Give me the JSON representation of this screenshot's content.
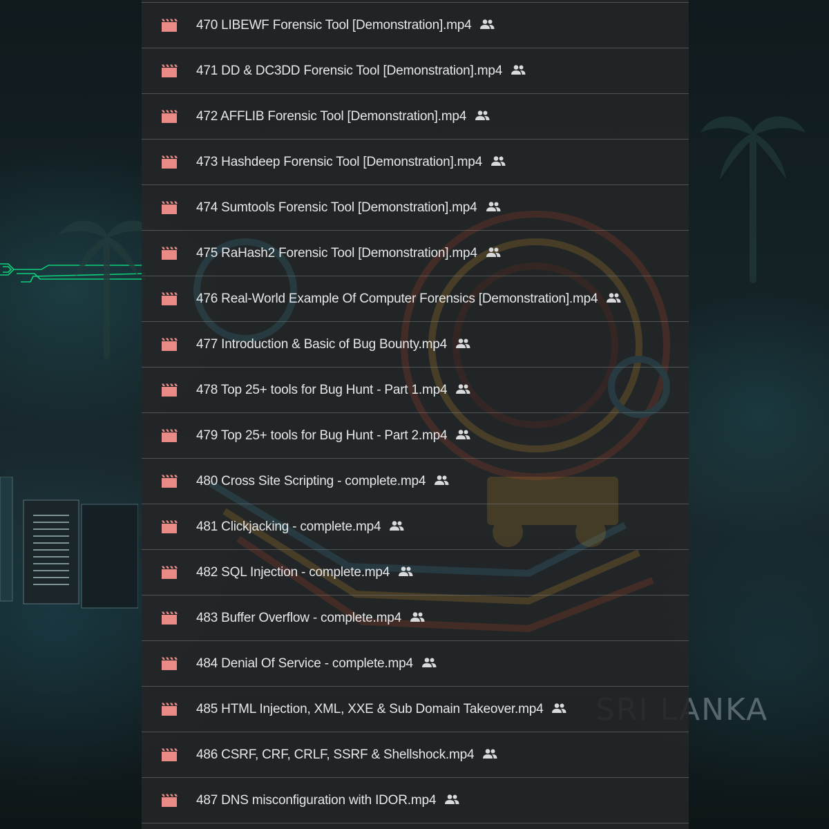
{
  "background": {
    "watermark_text": "SRI LANKA",
    "accent_color": "#0fd07a"
  },
  "file_list": {
    "file_icon": "video-file-icon",
    "shared_icon": "shared-people-icon",
    "file_icon_color": "#e98a86",
    "items": [
      {
        "name": "470 LIBEWF Forensic Tool [Demonstration].mp4",
        "shared": true
      },
      {
        "name": "471 DD & DC3DD Forensic Tool [Demonstration].mp4",
        "shared": true
      },
      {
        "name": "472 AFFLIB Forensic Tool [Demonstration].mp4",
        "shared": true
      },
      {
        "name": "473 Hashdeep Forensic Tool [Demonstration].mp4",
        "shared": true
      },
      {
        "name": "474 Sumtools Forensic Tool [Demonstration].mp4",
        "shared": true
      },
      {
        "name": "475 RaHash2 Forensic Tool [Demonstration].mp4",
        "shared": true
      },
      {
        "name": "476 Real-World Example Of Computer Forensics [Demonstration].mp4",
        "shared": true
      },
      {
        "name": "477 Introduction & Basic of Bug Bounty.mp4",
        "shared": true
      },
      {
        "name": "478 Top 25+ tools for Bug Hunt - Part 1.mp4",
        "shared": true
      },
      {
        "name": "479 Top 25+ tools for Bug Hunt - Part 2.mp4",
        "shared": true
      },
      {
        "name": "480 Cross Site Scripting - complete.mp4",
        "shared": true
      },
      {
        "name": "481 Clickjacking - complete.mp4",
        "shared": true
      },
      {
        "name": "482 SQL Injection - complete.mp4",
        "shared": true
      },
      {
        "name": "483 Buffer Overflow - complete.mp4",
        "shared": true
      },
      {
        "name": "484 Denial Of Service - complete.mp4",
        "shared": true
      },
      {
        "name": "485 HTML Injection, XML, XXE & Sub Domain Takeover.mp4",
        "shared": true
      },
      {
        "name": "486 CSRF, CRF, CRLF, SSRF & Shellshock.mp4",
        "shared": true
      },
      {
        "name": "487 DNS misconfiguration with IDOR.mp4",
        "shared": true
      }
    ]
  }
}
